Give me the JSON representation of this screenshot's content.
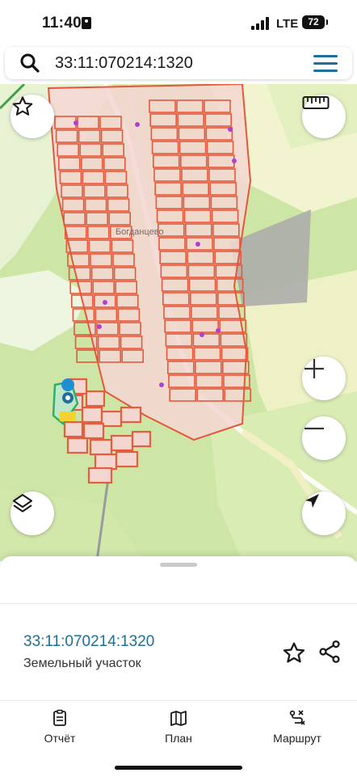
{
  "status_bar": {
    "time": "11:40",
    "network": "LTE",
    "battery": "72"
  },
  "search": {
    "query": "33:11:070214:1320"
  },
  "map": {
    "place_label": "Богданцево"
  },
  "sheet": {
    "cadastral_number": "33:11:070214:1320",
    "object_type": "Земельный участок"
  },
  "bottom_nav": {
    "items": [
      {
        "label": "Отчёт"
      },
      {
        "label": "План"
      },
      {
        "label": "Маршрут"
      }
    ]
  },
  "colors": {
    "accent": "#1f6f9a",
    "parcel_border": "#e3583a",
    "parcel_fill": "#f4d6d2",
    "forest": "#cfe7a8"
  }
}
